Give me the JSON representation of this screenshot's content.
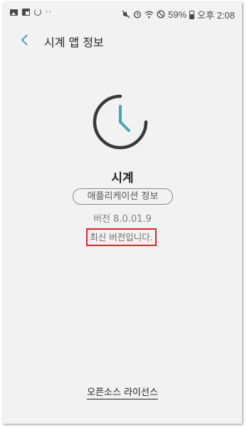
{
  "status_bar": {
    "battery": "59%",
    "time": "오후 2:08",
    "left_dots": "··"
  },
  "header": {
    "title": "시계 앱 정보"
  },
  "app": {
    "name": "시계",
    "info_button_label": "애플리케이션 정보",
    "version": "버전 8.0.01.9",
    "update_status": "최신 버전입니다."
  },
  "footer": {
    "license_link": "오픈소스 라이선스"
  },
  "colors": {
    "accent": "#4aa5ad",
    "highlight_border": "#d9262e",
    "background": "#f2f2f2"
  }
}
